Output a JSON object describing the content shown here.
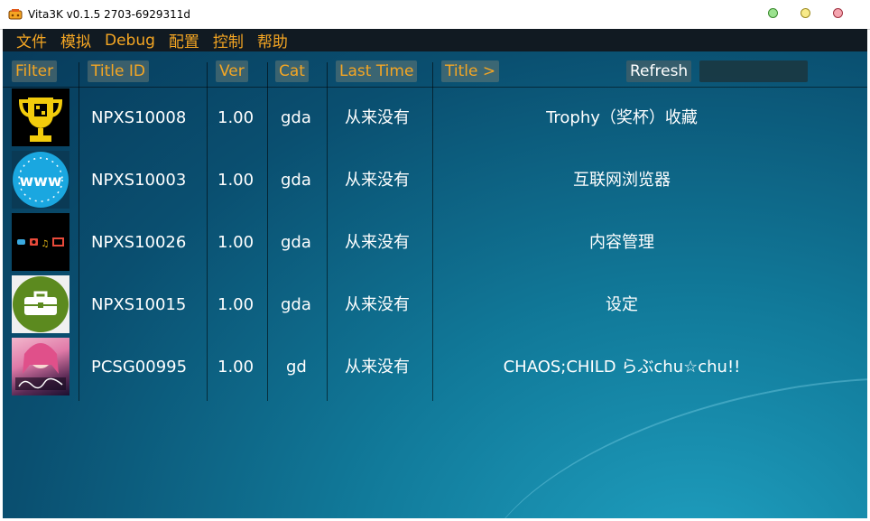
{
  "window": {
    "title": "Vita3K v0.1.5 2703-6929311d",
    "buttons": {
      "min_color": "#9be28f",
      "max_color": "#f7ea8a",
      "close_color": "#f5a5b0"
    }
  },
  "menu": [
    "文件",
    "模拟",
    "Debug",
    "配置",
    "控制",
    "帮助"
  ],
  "header": {
    "filter": "Filter",
    "title_id": "Title ID",
    "ver": "Ver",
    "cat": "Cat",
    "last_time": "Last Time",
    "title": "Title >",
    "refresh": "Refresh",
    "search_value": ""
  },
  "apps": [
    {
      "icon": "trophy-icon",
      "title_id": "NPXS10008",
      "ver": "1.00",
      "cat": "gda",
      "last_time": "从来没有",
      "title": "Trophy（奖杯）收藏"
    },
    {
      "icon": "www-icon",
      "title_id": "NPXS10003",
      "ver": "1.00",
      "cat": "gda",
      "last_time": "从来没有",
      "title": "互联网浏览器"
    },
    {
      "icon": "content-manager-icon",
      "title_id": "NPXS10026",
      "ver": "1.00",
      "cat": "gda",
      "last_time": "从来没有",
      "title": "内容管理"
    },
    {
      "icon": "settings-toolbox-icon",
      "title_id": "NPXS10015",
      "ver": "1.00",
      "cat": "gda",
      "last_time": "从来没有",
      "title": "设定"
    },
    {
      "icon": "game-cover-icon",
      "title_id": "PCSG00995",
      "ver": "1.00",
      "cat": "gd",
      "last_time": "从来没有",
      "title": "CHAOS;CHILD らぶchu☆chu!!"
    }
  ],
  "colors": {
    "accent": "#f5a623",
    "menubar": "#111a22",
    "background": "#0a4f70"
  }
}
